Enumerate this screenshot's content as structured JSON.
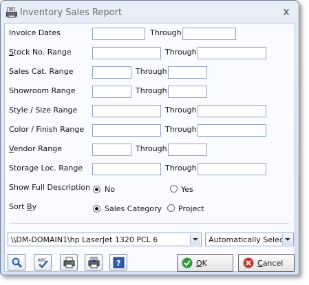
{
  "window": {
    "title": "Inventory Sales Report",
    "close_glyph": "x"
  },
  "fields": {
    "invoice_dates": {
      "label": "Invoice Dates",
      "through": "Through"
    },
    "stock_no": {
      "label_pre": "",
      "label_ul": "S",
      "label_post": "tock No. Range",
      "through": "Through"
    },
    "sales_cat": {
      "label": "Sales Cat. Range",
      "through": "Through"
    },
    "showroom": {
      "label": "Showroom Range",
      "through": "Through"
    },
    "style_size": {
      "label": "Style / Size Range",
      "through": "Through"
    },
    "color_finish": {
      "label": "Color / Finish Range",
      "through": "Through"
    },
    "vendor": {
      "label_pre": "",
      "label_ul": "V",
      "label_post": "endor Range",
      "through": "Through"
    },
    "storage_loc": {
      "label": "Storage Loc. Range",
      "through": "Through"
    }
  },
  "show_full_description": {
    "label": "Show Full Description",
    "options": [
      "No",
      "Yes"
    ],
    "selected": "No"
  },
  "sort_by": {
    "label_pre": "Sort ",
    "label_ul": "B",
    "label_post": "y",
    "options": [
      "Sales Category",
      "Project"
    ],
    "selected": "Sales Category"
  },
  "printer": {
    "value": "\\\\DM-DOMAIN1\\hp LaserJet 1320 PCL 6"
  },
  "tray": {
    "value": "Automatically Select"
  },
  "toolbar": {
    "icons": [
      "preview-icon",
      "spellcheck-icon",
      "print-icon",
      "printer-setup-icon",
      "help-icon"
    ]
  },
  "buttons": {
    "ok_ul": "O",
    "ok_rest": "K",
    "cancel_ul": "C",
    "cancel_rest": "ancel"
  },
  "colors": {
    "ok_green": "#2f9a3a",
    "cancel_red": "#c4382d",
    "accent": "#3a62a8"
  }
}
